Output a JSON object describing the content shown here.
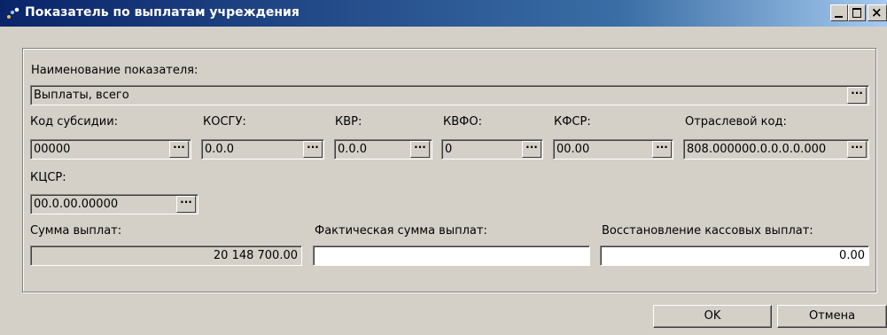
{
  "window": {
    "title": "Показатель по выплатам учреждения"
  },
  "form": {
    "name_label": "Наименование показателя:",
    "name_value": "Выплаты, всего",
    "subsidy_code_label": "Код субсидии:",
    "subsidy_code_value": "00000",
    "kosgu_label": "КОСГУ:",
    "kosgu_value": "0.0.0",
    "kvr_label": "КВР:",
    "kvr_value": "0.0.0",
    "kvfo_label": "КВФО:",
    "kvfo_value": "0",
    "kfsr_label": "КФСР:",
    "kfsr_value": "00.00",
    "industry_code_label": "Отраслевой код:",
    "industry_code_value": "808.000000.0.0.0.0.000",
    "kcsr_label": "КЦСР:",
    "kcsr_value": "00.0.00.00000",
    "payment_sum_label": "Сумма выплат:",
    "payment_sum_value": "20 148 700.00",
    "actual_sum_label": "Фактическая сумма выплат:",
    "actual_sum_value": "",
    "cash_restore_label": "Восстановление кассовых выплат:",
    "cash_restore_value": "0.00",
    "ellipsis": "···"
  },
  "buttons": {
    "ok": "OK",
    "cancel": "Отмена"
  },
  "icons": {
    "app": "app-icon",
    "minimize": "minimize-icon",
    "maximize": "maximize-icon",
    "close": "close-icon"
  }
}
